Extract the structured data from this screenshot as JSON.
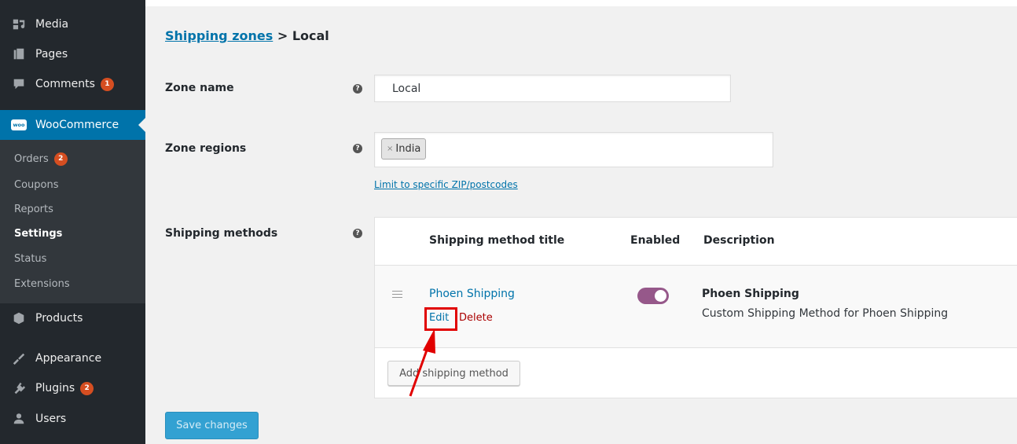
{
  "sidebar": {
    "items": [
      {
        "label": "Media",
        "icon": "media-icon"
      },
      {
        "label": "Pages",
        "icon": "pages-icon"
      },
      {
        "label": "Comments",
        "icon": "comments-icon",
        "badge": "1"
      },
      {
        "label": "WooCommerce",
        "icon": "woocommerce-icon",
        "icon_text": "woo"
      },
      {
        "label": "Products",
        "icon": "products-icon"
      },
      {
        "label": "Appearance",
        "icon": "appearance-icon"
      },
      {
        "label": "Plugins",
        "icon": "plugins-icon",
        "badge": "2"
      },
      {
        "label": "Users",
        "icon": "users-icon"
      }
    ],
    "submenu": [
      {
        "label": "Orders",
        "badge": "2"
      },
      {
        "label": "Coupons"
      },
      {
        "label": "Reports"
      },
      {
        "label": "Settings",
        "current": true
      },
      {
        "label": "Status"
      },
      {
        "label": "Extensions"
      }
    ]
  },
  "breadcrumb": {
    "link": "Shipping zones",
    "separator": " > ",
    "current": "Local"
  },
  "form": {
    "zone_name_label": "Zone name",
    "zone_name_value": "Local",
    "zone_regions_label": "Zone regions",
    "region_token_remove": "×",
    "region_token": "India",
    "zip_link": "Limit to specific ZIP/postcodes",
    "shipping_methods_label": "Shipping methods",
    "help_glyph": "?"
  },
  "methods_table": {
    "headers": [
      "Shipping method title",
      "Enabled",
      "Description"
    ],
    "rows": [
      {
        "title": "Phoen Shipping",
        "edit": "Edit",
        "delete": "Delete",
        "enabled": true,
        "desc_title": "Phoen Shipping",
        "desc_text": "Custom Shipping Method for Phoen Shipping"
      }
    ],
    "add_button": "Add shipping method"
  },
  "save_button": "Save changes",
  "colors": {
    "sidebar_bg": "#23282d",
    "accent": "#0073aa",
    "toggle_on": "#96588a",
    "highlight": "#e10000"
  }
}
